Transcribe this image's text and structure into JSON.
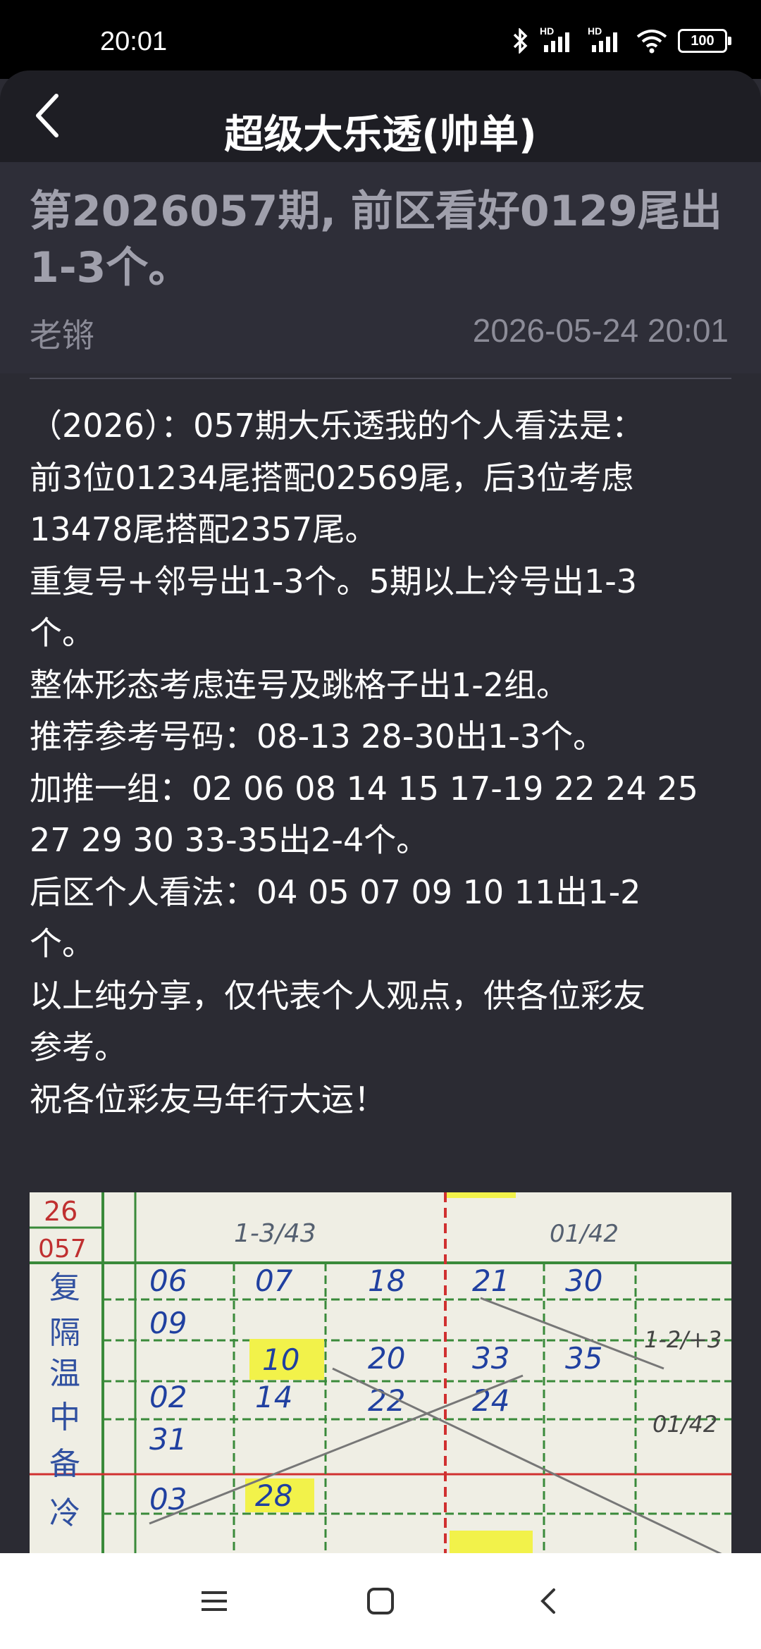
{
  "status_bar": {
    "time": "20:01",
    "network_1": "HD",
    "network_2": "HD",
    "battery": "100",
    "icons": [
      "bluetooth-icon",
      "signal-icon",
      "signal-icon",
      "wifi-icon",
      "battery-icon"
    ]
  },
  "header": {
    "title": "超级大乐透(帅单)",
    "back_icon": "chevron-left-icon"
  },
  "article": {
    "title_line_1": "第2026057期, 前区看好0129尾出",
    "title_line_2": "1-3个。",
    "author": "老锵",
    "date": "2026-05-24 20:01",
    "body_lines": [
      "（2026）：057期大乐透我的个人看法是：",
      "前3位01234尾搭配02569尾，后3位考虑",
      "13478尾搭配2357尾。",
      "重复号+邻号出1-3个。5期以上冷号出1-3",
      "个。",
      "整体形态考虑连号及跳格子出1-2组。",
      "推荐参考号码：08-13 28-30出1-3个。",
      "加推一组：02 06 08 14 15 17-19 22 24 25",
      "27 29 30 33-35出2-4个。",
      "后区个人看法：04 05 07 09 10 11出1-2",
      "个。",
      "以上纯分享，仅代表个人观点，供各位彩友",
      "参考。",
      "祝各位彩友马年行大运！"
    ]
  },
  "photo": {
    "left_column": [
      "26",
      "057",
      "复",
      "隔",
      "温",
      "中",
      "备",
      "冷"
    ],
    "header_left": "1-3/43",
    "header_right": "01/42",
    "rows": [
      [
        "06",
        "07",
        "18",
        "21",
        "30"
      ],
      [
        "09",
        "10",
        "20",
        "33",
        "35"
      ],
      [
        "02",
        "14",
        "22",
        "24",
        ""
      ],
      [
        "31",
        "",
        "",
        "",
        ""
      ],
      [
        "03",
        "28",
        "",
        "",
        ""
      ]
    ],
    "side_notes": [
      "1-2/+3",
      "01/42"
    ],
    "highlight_color": "#f2f24a"
  },
  "nav": {
    "icons": [
      "menu-icon",
      "home-icon",
      "back-icon"
    ]
  }
}
